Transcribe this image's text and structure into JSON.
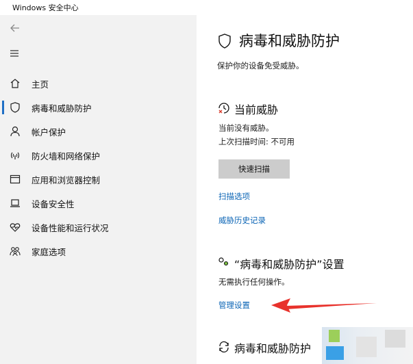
{
  "window": {
    "title": "Windows 安全中心"
  },
  "sidebar": {
    "back_icon": "back-arrow-icon",
    "menu_icon": "hamburger-icon",
    "items": [
      {
        "label": "主页",
        "icon": "home-icon"
      },
      {
        "label": "病毒和威胁防护",
        "icon": "shield-icon",
        "active": true
      },
      {
        "label": "帐户保护",
        "icon": "person-icon"
      },
      {
        "label": "防火墙和网络保护",
        "icon": "wifi-icon"
      },
      {
        "label": "应用和浏览器控制",
        "icon": "app-window-icon"
      },
      {
        "label": "设备安全性",
        "icon": "laptop-icon"
      },
      {
        "label": "设备性能和运行状况",
        "icon": "heart-icon"
      },
      {
        "label": "家庭选项",
        "icon": "family-icon"
      }
    ],
    "accent": "#1f6fc5"
  },
  "main": {
    "title": "病毒和威胁防护",
    "subtitle": "保护你的设备免受威胁。",
    "current_threats": {
      "heading": "当前威胁",
      "status": "当前没有威胁。",
      "last_scan": "上次扫描时间: 不可用",
      "quick_scan": "快速扫描",
      "scan_options": "扫描选项",
      "threat_history": "威胁历史记录"
    },
    "settings": {
      "heading": "“病毒和威胁防护”设置",
      "status": "无需执行任何操作。",
      "manage": "管理设置"
    },
    "updates": {
      "heading": "病毒和威胁防护"
    },
    "link_color": "#0a64b5",
    "arrow_color": "#e8322c"
  }
}
